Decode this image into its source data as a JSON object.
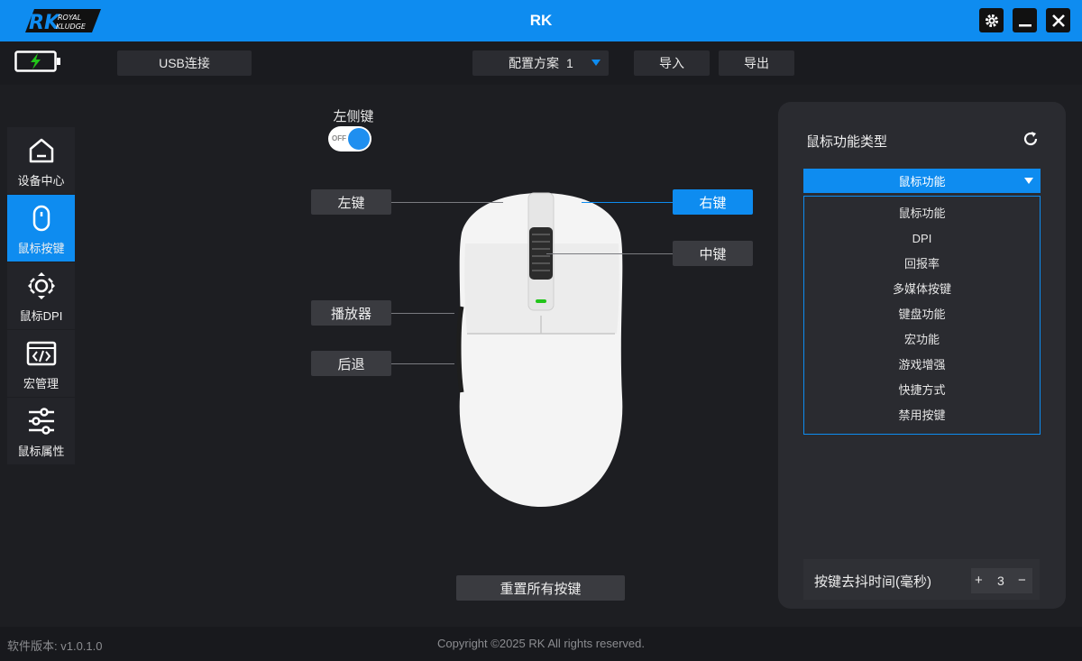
{
  "window": {
    "title": "RK",
    "logo_text": "RK ROYAL KLUDGE",
    "buttons": [
      "settings",
      "minimize",
      "close"
    ]
  },
  "toolbar": {
    "connection": "USB连接",
    "profile_label": "配置方案",
    "profile_value": "1",
    "import_label": "导入",
    "export_label": "导出",
    "battery_state": "charging"
  },
  "sidebar": {
    "items": [
      {
        "label": "设备中心",
        "icon": "home-icon",
        "active": false
      },
      {
        "label": "鼠标按键",
        "icon": "mouse-icon",
        "active": true
      },
      {
        "label": "鼠标DPI",
        "icon": "dpi-icon",
        "active": false
      },
      {
        "label": "宏管理",
        "icon": "code-window-icon",
        "active": false
      },
      {
        "label": "鼠标属性",
        "icon": "sliders-icon",
        "active": false
      }
    ]
  },
  "main": {
    "side_key_label": "左侧键",
    "side_key_toggle": "OFF",
    "buttons": {
      "left": "左键",
      "right": "右键",
      "middle": "中键",
      "forward": "播放器",
      "back": "后退"
    },
    "reset_label": "重置所有按键"
  },
  "panel": {
    "title": "鼠标功能类型",
    "selected": "鼠标功能",
    "options": [
      "鼠标功能",
      "DPI",
      "回报率",
      "多媒体按键",
      "键盘功能",
      "宏功能",
      "游戏增强",
      "快捷方式",
      "禁用按键"
    ],
    "debounce_label": "按键去抖时间(毫秒)",
    "debounce_value": "3",
    "plus": "+",
    "minus": "−"
  },
  "footer": {
    "version": "软件版本: v1.0.1.0",
    "copyright": "Copyright ©2025 RK All rights reserved."
  },
  "colors": {
    "accent": "#0e8cf0",
    "background": "#1d1e22",
    "panel": "#2a2b30",
    "battery": "#22c51a"
  }
}
